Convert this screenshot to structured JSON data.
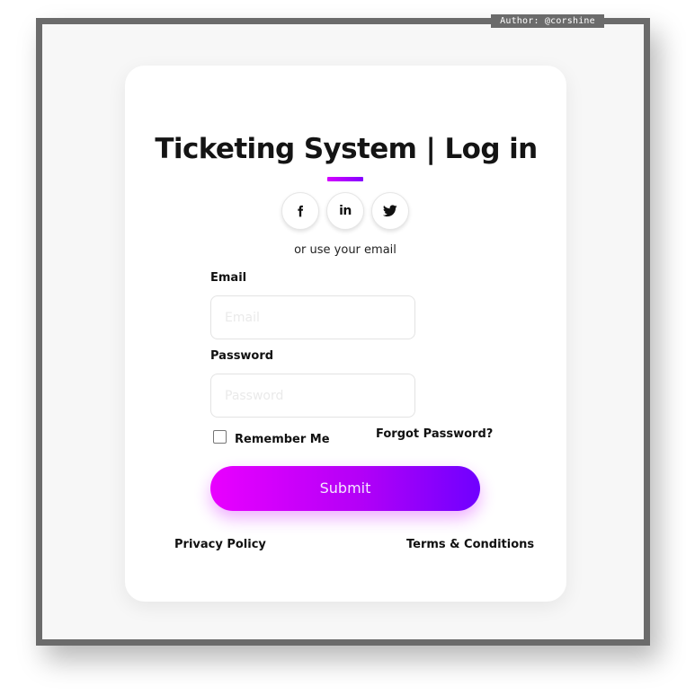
{
  "author_tag": "Author: @corshine",
  "header": {
    "title": "Ticketing System | Log in"
  },
  "social": {
    "facebook_icon": "facebook-icon",
    "linkedin_text": "in",
    "twitter_icon": "twitter-icon"
  },
  "divider_text": "or use your email",
  "form": {
    "email_label": "Email",
    "email_placeholder": "Email",
    "email_value": "",
    "password_label": "Password",
    "password_placeholder": "Password",
    "password_value": "",
    "remember_label": "Remember Me",
    "remember_checked": false,
    "forgot_label": "Forgot Password?",
    "submit_label": "Submit"
  },
  "footer": {
    "privacy_label": "Privacy Policy",
    "terms_label": "Terms & Conditions"
  },
  "colors": {
    "accent_start": "#e900ff",
    "accent_end": "#6f00ff",
    "frame_border": "#6b6b6b"
  }
}
